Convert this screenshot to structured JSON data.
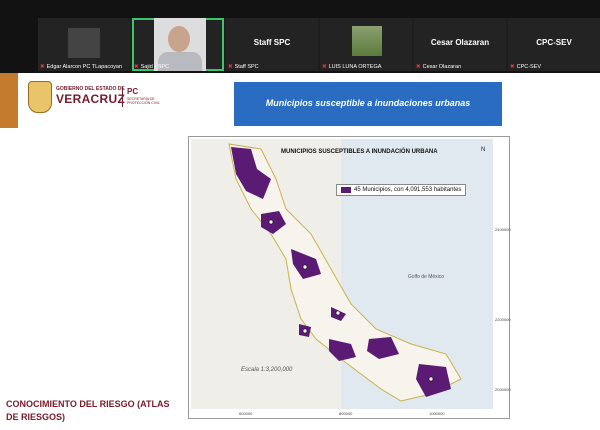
{
  "participants": [
    {
      "name": "Edgar Alarcon PC TLapacoyan",
      "center_text": "",
      "kind": "thumb"
    },
    {
      "name": "Sajid - SPC",
      "center_text": "",
      "kind": "face",
      "active": true
    },
    {
      "name": "Staff SPC",
      "center_text": "Staff SPC",
      "kind": "name"
    },
    {
      "name": "LUIS LUNA ORTEGA",
      "center_text": "",
      "kind": "landscape"
    },
    {
      "name": "Cesar Olazaran",
      "center_text": "Cesar Olazaran",
      "kind": "name"
    },
    {
      "name": "CPC-SEV",
      "center_text": "CPC-SEV",
      "kind": "name"
    }
  ],
  "slide": {
    "gov_top": "GOBIERNO DEL ESTADO DE",
    "gov_name": "VERACRUZ",
    "pc_logo": "PC",
    "pc_sub": "SECRETARÍA DE PROTECCIÓN CIVIL",
    "title": "Municipios susceptible a inundaciones urbanas",
    "footer_text": "CONOCIMIENTO DEL RIESGO (ATLAS DE RIESGOS)"
  },
  "map": {
    "title": "MUNICIPIOS SUSCEPTIBLES A INUNDACIÓN URBANA",
    "legend": "45 Municipios, con 4,091,553 habitantes",
    "sea_label": "Golfo de México",
    "scale": "Escala 1:3,200,000",
    "compass": "N",
    "fill_color": "#5b1a73",
    "grid_x": [
      "600000",
      "800000",
      "1000000"
    ],
    "grid_y": [
      "2400000",
      "2200000",
      "2000000"
    ]
  }
}
